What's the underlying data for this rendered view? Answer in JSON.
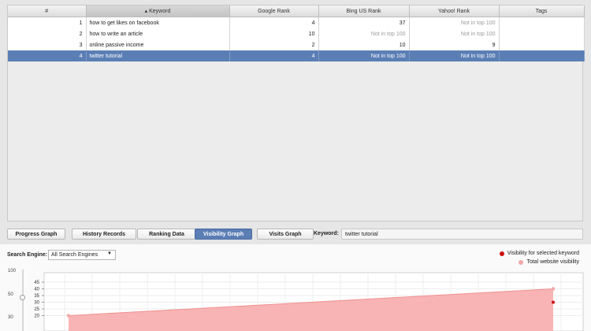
{
  "table": {
    "columns": [
      "#",
      "▴ Keyword",
      "Google Rank",
      "Bing US Rank",
      "Yahoo! Rank",
      "Tags"
    ],
    "rows": [
      {
        "num": "1",
        "keyword": "how to get likes on facebook",
        "google": "4",
        "bing": "37",
        "yahoo": "Not in top 100",
        "tags": ""
      },
      {
        "num": "2",
        "keyword": "how to write an article",
        "google": "10",
        "bing": "Not in top 100",
        "yahoo": "Not in top 100",
        "tags": ""
      },
      {
        "num": "3",
        "keyword": "online passive income",
        "google": "2",
        "bing": "10",
        "yahoo": "9",
        "tags": ""
      },
      {
        "num": "4",
        "keyword": "twitter tutorial",
        "google": "4",
        "bing": "Not in top 100",
        "yahoo": "Not in top 100",
        "tags": ""
      }
    ]
  },
  "tabs": [
    "Progress Graph",
    "History Records",
    "Ranking Data",
    "Visibility Graph",
    "Visits Graph"
  ],
  "keyword_label": "Keyword:",
  "keyword_value": "twitter tutorial",
  "search_engine_label": "Search Engine:",
  "search_engine_value": "All Search Engines",
  "legend": [
    {
      "label": "Visibility for selected keyword",
      "color": "#cc1111"
    },
    {
      "label": "Total website visibility",
      "color": "#f4a7a7"
    }
  ],
  "slider_labels": [
    "100",
    "50",
    "30"
  ],
  "chart_data": {
    "type": "area",
    "y_ticks": [
      20,
      25,
      30,
      35,
      40,
      45
    ],
    "ylim": [
      15,
      47
    ],
    "series": [
      {
        "name": "Total website visibility",
        "values": [
          20,
          40
        ]
      },
      {
        "name": "Visibility for selected keyword",
        "values": [
          null,
          30
        ]
      }
    ]
  }
}
